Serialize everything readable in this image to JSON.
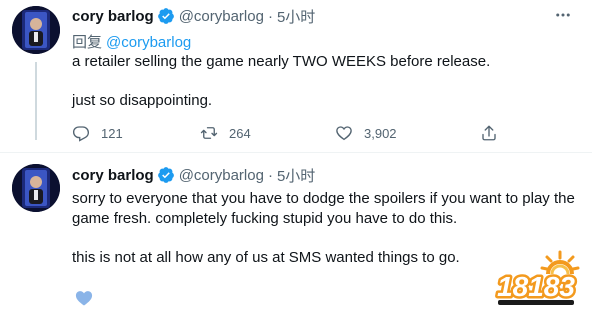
{
  "tweets": [
    {
      "name": "cory barlog",
      "handle": "@corybarlog",
      "dot": "·",
      "time": "5小时",
      "reply_prefix": "回复",
      "reply_handle": "@corybarlog",
      "lines": [
        "a retailer selling the game nearly TWO WEEKS before release.",
        "just so disappointing."
      ],
      "stats": {
        "replies": "121",
        "retweets": "264",
        "likes": "3,902"
      }
    },
    {
      "name": "cory barlog",
      "handle": "@corybarlog",
      "dot": "·",
      "time": "5小时",
      "lines": [
        "sorry to everyone that you have to dodge the spoilers if you want to play the",
        "game fresh. completely fucking stupid you have to do this.",
        "this is not at all how any of us at SMS wanted things to go."
      ]
    }
  ],
  "watermark": {
    "text": "18183"
  },
  "colors": {
    "accent": "#1d9bf0",
    "muted": "#536471",
    "text": "#0f1419",
    "watermark_orange": "#f39a1e"
  },
  "icons": [
    "more-icon",
    "verified-icon",
    "reply-icon",
    "retweet-icon",
    "like-icon",
    "share-icon",
    "avatar"
  ]
}
